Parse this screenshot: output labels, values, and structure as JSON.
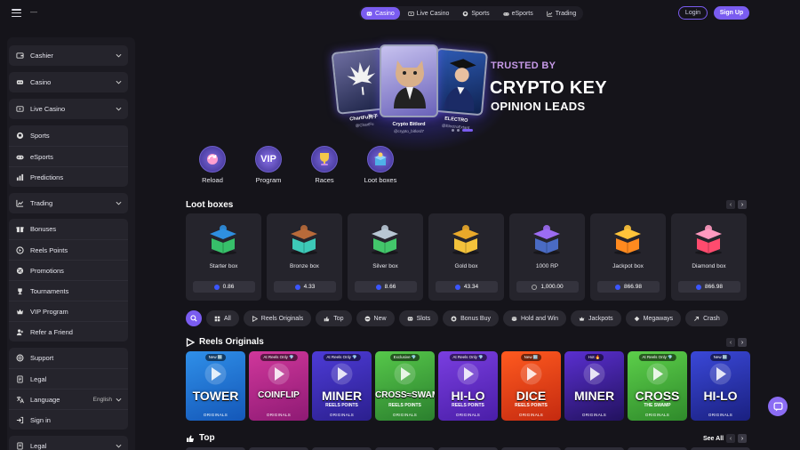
{
  "header": {
    "menu_dots": "—",
    "tabs": [
      {
        "label": "Casino",
        "icon": "casino-icon",
        "active": true
      },
      {
        "label": "Live Casino",
        "icon": "live-casino-icon",
        "active": false
      },
      {
        "label": "Sports",
        "icon": "sports-icon",
        "active": false
      },
      {
        "label": "eSports",
        "icon": "esports-icon",
        "active": false
      },
      {
        "label": "Trading",
        "icon": "trading-icon",
        "active": false
      }
    ],
    "login_label": "Login",
    "signup_label": "Sign Up"
  },
  "sidebar": {
    "group1": [
      {
        "label": "Cashier",
        "icon": "wallet-icon"
      }
    ],
    "group2": [
      {
        "label": "Casino",
        "icon": "casino-icon"
      }
    ],
    "group3": [
      {
        "label": "Live Casino",
        "icon": "live-casino-icon"
      }
    ],
    "group4": [
      {
        "label": "Sports",
        "icon": "sports-icon"
      },
      {
        "label": "eSports",
        "icon": "esports-icon"
      },
      {
        "label": "Predictions",
        "icon": "predictions-icon"
      }
    ],
    "group5": [
      {
        "label": "Trading",
        "icon": "trading-icon"
      }
    ],
    "group6": [
      {
        "label": "Bonuses",
        "icon": "bonus-icon"
      },
      {
        "label": "Reels Points",
        "icon": "points-icon"
      },
      {
        "label": "Promotions",
        "icon": "promotions-icon"
      },
      {
        "label": "Tournaments",
        "icon": "trophy-icon"
      },
      {
        "label": "VIP Program",
        "icon": "crown-icon"
      },
      {
        "label": "Refer a Friend",
        "icon": "refer-icon"
      }
    ],
    "group7": [
      {
        "label": "Support",
        "icon": "support-icon"
      },
      {
        "label": "Legal",
        "icon": "legal-icon"
      },
      {
        "label": "Language",
        "icon": "language-icon",
        "value": "English"
      },
      {
        "label": "Sign in",
        "icon": "sign-in-icon"
      }
    ],
    "group8": [
      {
        "label": "Legal",
        "icon": "legal-icon"
      }
    ]
  },
  "banner": {
    "eyebrow": "TRUSTED BY",
    "title": "CRYPTO KEY",
    "subtitle": "OPINION LEADS",
    "cards": [
      {
        "name": "ChartFu狗子",
        "handle": "@ChartFu"
      },
      {
        "name": "Crypto Bitlord",
        "handle": "@crypto_bitlord7"
      },
      {
        "name": "ELECTRO",
        "handle": "@ElectroExtant"
      }
    ],
    "slide_index": 3,
    "slide_count": 3
  },
  "promos": [
    {
      "label": "Reload",
      "icon": "reload-icon"
    },
    {
      "label": "Program",
      "icon": "vip-icon"
    },
    {
      "label": "Races",
      "icon": "trophy-icon"
    },
    {
      "label": "Loot boxes",
      "icon": "loot-box-icon"
    }
  ],
  "promo_vip_text": "VIP",
  "loot": {
    "title": "Loot boxes",
    "items": [
      {
        "name": "Starter box",
        "price": "0.86",
        "color": "#37c06a",
        "lid": "#2f8fe0",
        "currency": "coin"
      },
      {
        "name": "Bronze box",
        "price": "4.33",
        "color": "#3dc9b8",
        "lid": "#b86a3a",
        "currency": "coin"
      },
      {
        "name": "Silver box",
        "price": "8.66",
        "color": "#43c76b",
        "lid": "#b8c7d4",
        "currency": "coin"
      },
      {
        "name": "Gold box",
        "price": "43.34",
        "color": "#f3c23b",
        "lid": "#e9a92a",
        "currency": "coin"
      },
      {
        "name": "1000 RP",
        "price": "1,000.00",
        "color": "#4a6bc4",
        "lid": "#9c6cf2",
        "currency": "rp"
      },
      {
        "name": "Jackpot box",
        "price": "866.98",
        "color": "#ff8a1f",
        "lid": "#ffc43a",
        "currency": "coin"
      },
      {
        "name": "Diamond box",
        "price": "866.98",
        "color": "#ff4b6e",
        "lid": "#ff9ac0",
        "currency": "coin"
      }
    ]
  },
  "filters": [
    {
      "label": "All",
      "icon": "grid-icon"
    },
    {
      "label": "Reels Originals",
      "icon": "reels-icon"
    },
    {
      "label": "Top",
      "icon": "thumbs-up-icon"
    },
    {
      "label": "New",
      "icon": "new-icon"
    },
    {
      "label": "Slots",
      "icon": "slots-icon"
    },
    {
      "label": "Bonus Buy",
      "icon": "bonus-buy-icon"
    },
    {
      "label": "Hold and Win",
      "icon": "hold-win-icon"
    },
    {
      "label": "Jackpots",
      "icon": "crown-icon"
    },
    {
      "label": "Megaways",
      "icon": "megaways-icon"
    },
    {
      "label": "Crash",
      "icon": "crash-icon"
    }
  ],
  "originals": {
    "title": "Reels Originals",
    "games": [
      {
        "tag": "New 🆕",
        "title": "TOWER",
        "sub": "",
        "bg": "#2f8fe8",
        "bg2": "#1457b8"
      },
      {
        "tag": "At Reels Only 💎",
        "title": "COINFLIP",
        "sub": "",
        "bg": "#d0379b",
        "bg2": "#8e1a74"
      },
      {
        "tag": "At Reels Only 💎",
        "title": "MINER",
        "sub": "REELS POINTS",
        "bg": "#4d3bd6",
        "bg2": "#2b1f8e"
      },
      {
        "tag": "Exclusive 💎",
        "title": "CROSS≈SWAMP",
        "sub": "REELS POINTS",
        "bg": "#56c84a",
        "bg2": "#2b7f2e"
      },
      {
        "tag": "At Reels Only 💎",
        "title": "HI-LO",
        "sub": "REELS POINTS",
        "bg": "#7a3ee0",
        "bg2": "#4a1ea8"
      },
      {
        "tag": "New 🆕",
        "title": "DICE",
        "sub": "REELS POINTS",
        "bg": "#ff5a1f",
        "bg2": "#c42a10"
      },
      {
        "tag": "Hot 🔥",
        "title": "MINER",
        "sub": "",
        "bg": "#5a2fd0",
        "bg2": "#22125e"
      },
      {
        "tag": "At Reels Only 💎",
        "title": "CROSS",
        "sub": "THE SWAMP",
        "bg": "#5ccf4a",
        "bg2": "#2f8a2b"
      },
      {
        "tag": "New 🆕",
        "title": "HI-LO",
        "sub": "",
        "bg": "#3a48d8",
        "bg2": "#1a2080"
      }
    ],
    "originals_label": "ORIGINALS"
  },
  "top_section": {
    "title": "Top",
    "see_all": "See All"
  }
}
